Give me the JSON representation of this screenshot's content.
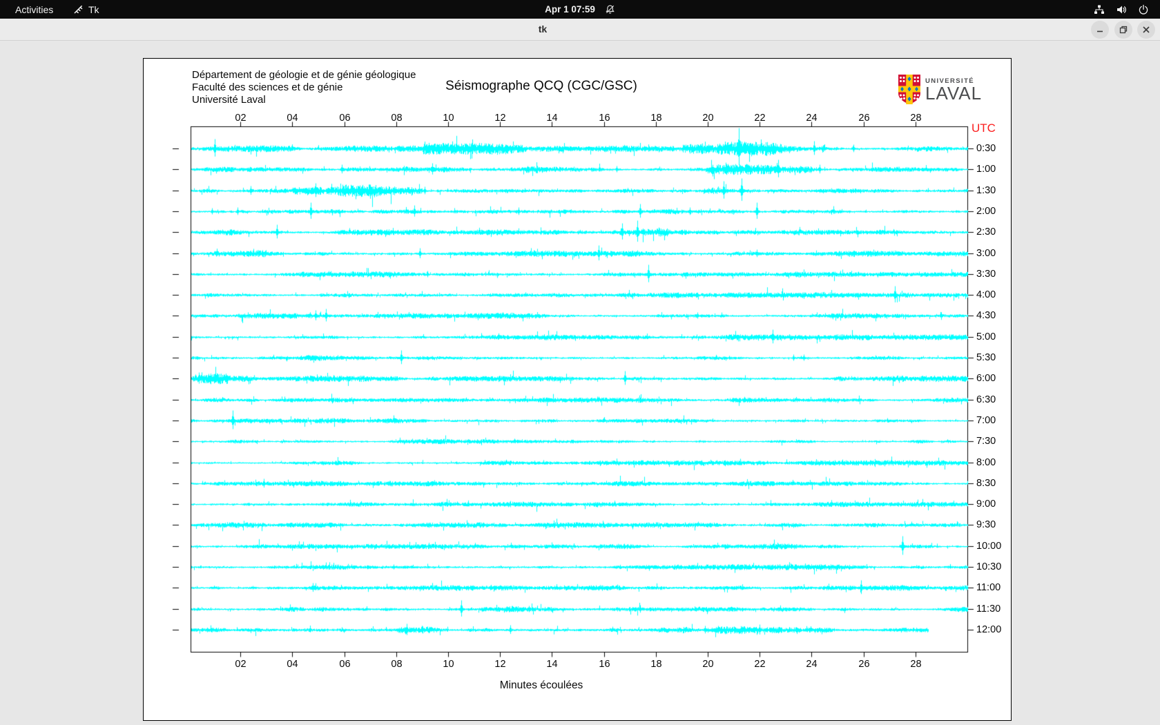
{
  "topbar": {
    "activities_label": "Activities",
    "app_name": "Tk",
    "clock": "Apr 1  07:59"
  },
  "titlebar": {
    "title": "tk"
  },
  "panel": {
    "header_lines": [
      "Département de géologie et de génie géologique",
      "Faculté des sciences et de génie",
      "Université Laval"
    ],
    "title": "Séismographe QCQ (CGC/GSC)",
    "utc_label": "UTC",
    "xlabel": "Minutes écoulées",
    "logo": {
      "line1": "UNIVERSITÉ",
      "line2": "LAVAL"
    }
  },
  "colors": {
    "trace": "#00ffff",
    "utc_label": "#fb1d1d",
    "axis": "#000000",
    "panel_bg": "#ffffff",
    "topbar_bg": "#0c0c0c",
    "titlebar_bg": "#ebebeb",
    "desktop_bg": "#e7e7e7",
    "logo_red": "#d21034",
    "logo_gold": "#ffc60b",
    "logo_blue": "#0077c8"
  },
  "chart_data": {
    "type": "line",
    "subtype": "seismogram-helicorder",
    "title": "Séismographe QCQ (CGC/GSC)",
    "xlabel": "Minutes écoulées",
    "right_axis_label": "UTC",
    "x_range": [
      0,
      30
    ],
    "x_tick_values": [
      2,
      4,
      6,
      8,
      10,
      12,
      14,
      16,
      18,
      20,
      22,
      24,
      26,
      28
    ],
    "x_tick_labels": [
      "02",
      "04",
      "06",
      "08",
      "10",
      "12",
      "14",
      "16",
      "18",
      "20",
      "22",
      "24",
      "26",
      "28"
    ],
    "trace_color": "#00ffff",
    "grid": false,
    "rows": [
      {
        "time": "0:30",
        "base": 1.6,
        "end": 30,
        "bursts": [
          [
            9,
            13,
            1.8
          ],
          [
            19,
            24.5,
            2.2
          ]
        ],
        "spikes": [
          [
            1.0,
            14
          ],
          [
            9.7,
            6
          ],
          [
            12.3,
            5
          ],
          [
            21.2,
            30
          ],
          [
            22.6,
            8
          ],
          [
            24.1,
            11
          ],
          [
            25.6,
            6
          ]
        ]
      },
      {
        "time": "1:00",
        "base": 1.5,
        "end": 30,
        "bursts": [
          [
            13,
            16,
            1.5
          ],
          [
            20,
            24,
            1.8
          ]
        ],
        "spikes": [
          [
            5.9,
            7
          ],
          [
            9.4,
            9
          ],
          [
            16.5,
            5
          ],
          [
            21.5,
            8
          ],
          [
            22.7,
            14
          ],
          [
            24.3,
            7
          ]
        ]
      },
      {
        "time": "1:30",
        "base": 1.6,
        "end": 30,
        "bursts": [
          [
            4,
            9,
            1.9
          ],
          [
            19.5,
            22,
            1.7
          ]
        ],
        "spikes": [
          [
            2.4,
            7
          ],
          [
            4.9,
            11
          ],
          [
            6.6,
            8
          ],
          [
            9.1,
            6
          ],
          [
            20.6,
            14
          ],
          [
            21.3,
            18
          ]
        ]
      },
      {
        "time": "2:00",
        "base": 1.6,
        "end": 30,
        "bursts": [
          [
            11,
            14.5,
            1.7
          ],
          [
            16,
            19,
            1.4
          ]
        ],
        "spikes": [
          [
            0.9,
            5
          ],
          [
            1.9,
            6
          ],
          [
            4.7,
            13
          ],
          [
            8.7,
            9
          ],
          [
            12.7,
            6
          ],
          [
            17.4,
            11
          ],
          [
            19.3,
            6
          ],
          [
            21.9,
            13
          ]
        ]
      },
      {
        "time": "2:30",
        "base": 1.5,
        "end": 30,
        "bursts": [
          [
            15,
            18.5,
            1.7
          ]
        ],
        "spikes": [
          [
            3.4,
            11
          ],
          [
            16.7,
            13
          ],
          [
            17.3,
            17
          ],
          [
            18.1,
            7
          ]
        ]
      },
      {
        "time": "3:00",
        "base": 1.5,
        "end": 30,
        "bursts": [
          [
            1,
            3,
            1.4
          ]
        ],
        "spikes": [
          [
            8.9,
            8
          ],
          [
            13.3,
            5
          ],
          [
            15.8,
            12
          ],
          [
            21.9,
            6
          ]
        ]
      },
      {
        "time": "3:30",
        "base": 1.4,
        "end": 30,
        "bursts": [],
        "spikes": [
          [
            9.2,
            5
          ],
          [
            17.7,
            14
          ],
          [
            25.8,
            4
          ]
        ]
      },
      {
        "time": "4:00",
        "base": 1.4,
        "end": 30,
        "bursts": [],
        "spikes": [
          [
            27.2,
            13
          ]
        ]
      },
      {
        "time": "4:30",
        "base": 1.4,
        "end": 30,
        "bursts": [],
        "spikes": [
          [
            4.9,
            8
          ],
          [
            5.3,
            10
          ],
          [
            19.6,
            5
          ]
        ]
      },
      {
        "time": "5:00",
        "base": 1.4,
        "end": 30,
        "bursts": [],
        "spikes": [
          [
            20.9,
            4
          ],
          [
            22.5,
            11
          ]
        ]
      },
      {
        "time": "5:30",
        "base": 1.4,
        "end": 30,
        "bursts": [],
        "spikes": [
          [
            8.2,
            11
          ],
          [
            23.3,
            5
          ],
          [
            23.7,
            5
          ]
        ]
      },
      {
        "time": "6:00",
        "base": 1.5,
        "end": 30,
        "bursts": [
          [
            0,
            1.5,
            1.8
          ]
        ],
        "spikes": [
          [
            0.4,
            9
          ],
          [
            1.0,
            7
          ],
          [
            6.1,
            4
          ],
          [
            16.8,
            11
          ]
        ]
      },
      {
        "time": "6:30",
        "base": 1.3,
        "end": 30,
        "bursts": [],
        "spikes": []
      },
      {
        "time": "7:00",
        "base": 1.4,
        "end": 30,
        "bursts": [],
        "spikes": [
          [
            1.7,
            15
          ]
        ]
      },
      {
        "time": "7:30",
        "base": 1.3,
        "end": 30,
        "bursts": [],
        "spikes": []
      },
      {
        "time": "8:00",
        "base": 1.3,
        "end": 30,
        "bursts": [],
        "spikes": []
      },
      {
        "time": "8:30",
        "base": 1.3,
        "end": 30,
        "bursts": [],
        "spikes": [
          [
            2.9,
            7
          ]
        ]
      },
      {
        "time": "9:00",
        "base": 1.3,
        "end": 30,
        "bursts": [],
        "spikes": []
      },
      {
        "time": "9:30",
        "base": 1.4,
        "end": 30,
        "bursts": [],
        "spikes": []
      },
      {
        "time": "10:00",
        "base": 1.4,
        "end": 30,
        "bursts": [],
        "spikes": [
          [
            27.5,
            15
          ]
        ]
      },
      {
        "time": "10:30",
        "base": 1.4,
        "end": 30,
        "bursts": [],
        "spikes": [
          [
            7.9,
            4
          ],
          [
            21.6,
            4
          ]
        ]
      },
      {
        "time": "11:00",
        "base": 1.4,
        "end": 30,
        "bursts": [],
        "spikes": [
          [
            4.8,
            7
          ],
          [
            25.9,
            11
          ]
        ]
      },
      {
        "time": "11:30",
        "base": 1.5,
        "end": 30,
        "bursts": [
          [
            10,
            14,
            1.5
          ]
        ],
        "spikes": [
          [
            10.5,
            13
          ],
          [
            13.1,
            5
          ],
          [
            17.4,
            6
          ]
        ]
      },
      {
        "time": "12:00",
        "base": 1.9,
        "end": 28.5,
        "bursts": [
          [
            7,
            10,
            1.5
          ],
          [
            19,
            24,
            1.6
          ]
        ],
        "spikes": [
          [
            8.4,
            9
          ],
          [
            12.4,
            7
          ],
          [
            19.9,
            6
          ],
          [
            20.4,
            6
          ],
          [
            22.0,
            8
          ]
        ]
      }
    ]
  }
}
